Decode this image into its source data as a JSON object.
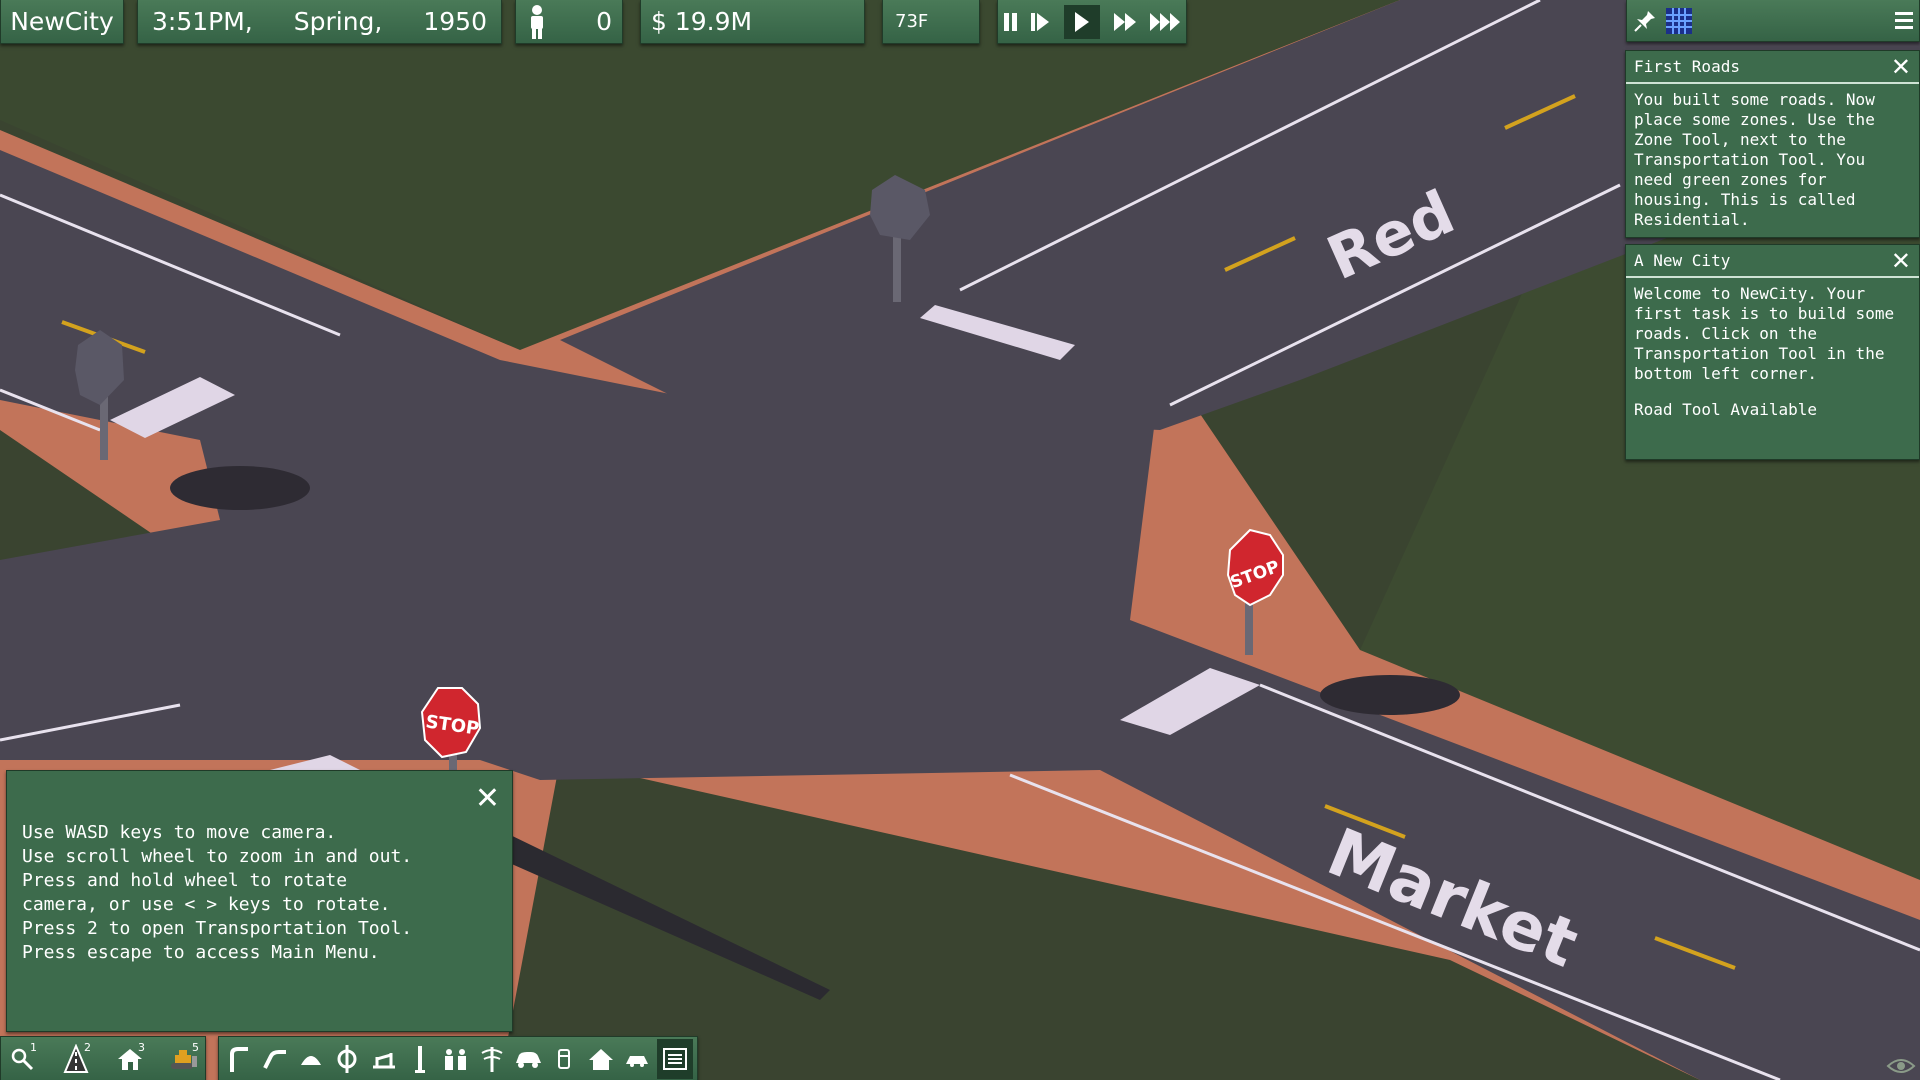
{
  "hud": {
    "city_name": "NewCity",
    "time": "3:51PM,",
    "season": "Spring,",
    "year": "1950",
    "population": "0",
    "money": "$ 19.9M",
    "temperature": "73F"
  },
  "speed_controls": [
    "pause-icon",
    "step-icon",
    "play-icon",
    "fast-icon",
    "fastest-icon"
  ],
  "messages": [
    {
      "title": "First Roads",
      "body": "You built some roads. Now place some zones. Use the Zone Tool, next to the Transportation Tool. You need green zones for housing. This is called Residential."
    },
    {
      "title": "A New City",
      "body": "Welcome to NewCity. Your first task is to build some roads. Click on the Transportation Tool in the bottom left corner.",
      "footer": "Road Tool Available"
    }
  ],
  "help_panel": {
    "text": "Use WASD keys to move camera.\nUse scroll wheel to zoom in and out.\nPress and hold wheel to rotate\ncamera, or use < > keys to rotate.\nPress 2 to open Transportation Tool.\nPress escape to access Main Menu."
  },
  "road_labels": {
    "red": "Red",
    "market": "Market"
  },
  "signs": {
    "stop": "STOP"
  },
  "toolbar": {
    "left_tools": [
      {
        "icon": "magnifier-icon",
        "num": "1"
      },
      {
        "icon": "road-cone-icon",
        "num": "2"
      },
      {
        "icon": "house-icon",
        "num": "3"
      },
      {
        "icon": "bulldozer-icon",
        "num": "5"
      }
    ],
    "right_tools": [
      "road-icon",
      "street-icon",
      "tunnel-icon",
      "interchange-icon",
      "bridge-icon",
      "pylon-icon",
      "people-icon",
      "health-icon",
      "car-icon",
      "bus-icon",
      "home-icon",
      "vehicle-icon",
      "messages-icon"
    ]
  },
  "colors": {
    "panel": "#3d6b4c",
    "grass": "#3d4a2e",
    "asphalt": "#4a4652",
    "curb": "#c47a60",
    "stop": "#d0262e"
  }
}
